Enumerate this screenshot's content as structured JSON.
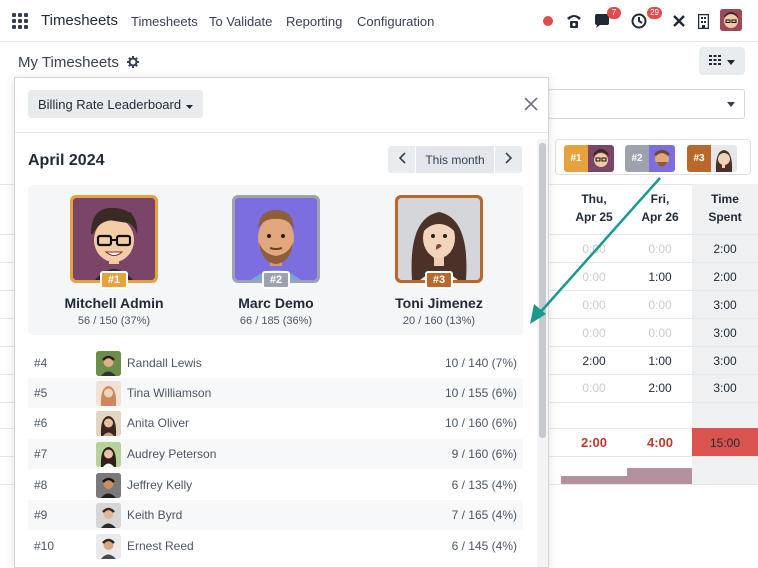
{
  "navbar": {
    "brand": "Timesheets",
    "menu": [
      "Timesheets",
      "To Validate",
      "Reporting",
      "Configuration"
    ],
    "messages_count": "7",
    "activities_count": "29"
  },
  "subbar": {
    "title": "My Timesheets"
  },
  "grid": {
    "columns": [
      {
        "day": "Thu,",
        "date": "Apr 25"
      },
      {
        "day": "Fri,",
        "date": "Apr 26"
      }
    ],
    "time_header": [
      "Time",
      "Spent"
    ],
    "rows": [
      [
        "0:00",
        "0:00",
        "2:00"
      ],
      [
        "0:00",
        "1:00",
        "2:00"
      ],
      [
        "0:00",
        "0:00",
        "3:00"
      ],
      [
        "0:00",
        "0:00",
        "3:00"
      ],
      [
        "2:00",
        "1:00",
        "3:00"
      ],
      [
        "0:00",
        "2:00",
        "3:00"
      ]
    ],
    "totals": [
      "2:00",
      "4:00",
      "15:00"
    ],
    "mini_leaders": [
      "#1",
      "#2",
      "#3"
    ]
  },
  "popover": {
    "selector_label": "Billing Rate Leaderboard",
    "month": "April 2024",
    "period_label": "This month",
    "podium": [
      {
        "rank": "#1",
        "name": "Mitchell Admin",
        "stat": "56 / 150 (37%)",
        "color": "#e6a23c"
      },
      {
        "rank": "#2",
        "name": "Marc Demo",
        "stat": "66 / 185 (36%)",
        "color": "#9ca3af"
      },
      {
        "rank": "#3",
        "name": "Toni Jimenez",
        "stat": "20 / 160 (13%)",
        "color": "#b7682a"
      }
    ],
    "leaders": [
      {
        "rank": "#4",
        "name": "Randall Lewis",
        "stat": "10 / 140 (7%)"
      },
      {
        "rank": "#5",
        "name": "Tina Williamson",
        "stat": "10 / 155 (6%)"
      },
      {
        "rank": "#6",
        "name": "Anita Oliver",
        "stat": "10 / 160 (6%)"
      },
      {
        "rank": "#7",
        "name": "Audrey Peterson",
        "stat": "9 / 160 (6%)"
      },
      {
        "rank": "#8",
        "name": "Jeffrey Kelly",
        "stat": "6 / 135 (4%)"
      },
      {
        "rank": "#9",
        "name": "Keith Byrd",
        "stat": "7 / 165 (4%)"
      },
      {
        "rank": "#10",
        "name": "Ernest Reed",
        "stat": "6 / 145 (4%)"
      }
    ]
  },
  "colors": {
    "gold": "#e6a23c",
    "silver": "#9ca3af",
    "bronze": "#b7682a",
    "arrow": "#1a9a8e",
    "total_red": "#d9534f"
  }
}
